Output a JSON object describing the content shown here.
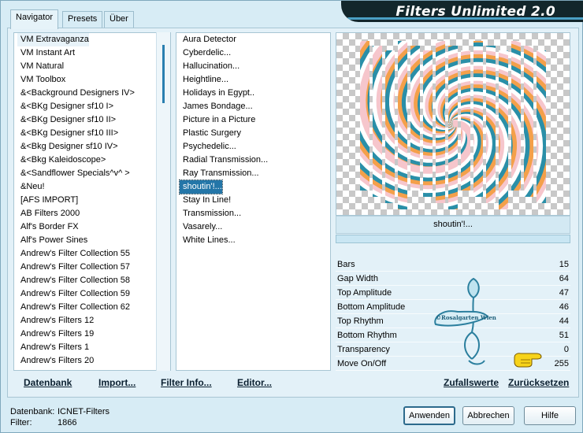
{
  "tabs": [
    {
      "label": "Navigator",
      "active": true
    },
    {
      "label": "Presets",
      "active": false
    },
    {
      "label": "Über",
      "active": false
    }
  ],
  "title": "Filters Unlimited 2.0",
  "categories": [
    {
      "label": "VM Extravaganza",
      "selected": false,
      "current": true
    },
    {
      "label": "VM Instant Art"
    },
    {
      "label": "VM Natural"
    },
    {
      "label": "VM Toolbox"
    },
    {
      "label": "&<Background Designers IV>"
    },
    {
      "label": "&<BKg Designer sf10 I>"
    },
    {
      "label": "&<BKg Designer sf10 II>"
    },
    {
      "label": "&<BKg Designer sf10 III>"
    },
    {
      "label": "&<Bkg Designer sf10 IV>"
    },
    {
      "label": "&<Bkg Kaleidoscope>"
    },
    {
      "label": "&<Sandflower Specials^v^ >"
    },
    {
      "label": "&Neu!"
    },
    {
      "label": "[AFS IMPORT]"
    },
    {
      "label": "AB Filters 2000"
    },
    {
      "label": "Alf's Border FX"
    },
    {
      "label": "Alf's Power Sines"
    },
    {
      "label": "Andrew's Filter Collection 55"
    },
    {
      "label": "Andrew's Filter Collection 57"
    },
    {
      "label": "Andrew's Filter Collection 58"
    },
    {
      "label": "Andrew's Filter Collection 59"
    },
    {
      "label": "Andrew's Filter Collection 62"
    },
    {
      "label": "Andrew's Filters 12"
    },
    {
      "label": "Andrew's Filters 19"
    },
    {
      "label": "Andrew's Filters 1"
    },
    {
      "label": "Andrew's Filters 20"
    }
  ],
  "filters": [
    {
      "label": "Aura Detector"
    },
    {
      "label": "Cyberdelic..."
    },
    {
      "label": "Hallucination..."
    },
    {
      "label": "Heightline..."
    },
    {
      "label": "Holidays in Egypt.."
    },
    {
      "label": "James Bondage..."
    },
    {
      "label": "Picture in a Picture"
    },
    {
      "label": "Plastic Surgery"
    },
    {
      "label": "Psychedelic..."
    },
    {
      "label": "Radial Transmission..."
    },
    {
      "label": "Ray Transmission..."
    },
    {
      "label": "shoutin'!...",
      "selected": true
    },
    {
      "label": "Stay In Line!"
    },
    {
      "label": "Transmission..."
    },
    {
      "label": "Vasarely..."
    },
    {
      "label": "White Lines..."
    }
  ],
  "preview": {
    "filter_name": "shoutin'!..."
  },
  "params": [
    {
      "label": "Bars",
      "value": "15"
    },
    {
      "label": "Gap Width",
      "value": "64"
    },
    {
      "label": "Top Amplitude",
      "value": "47"
    },
    {
      "label": "Bottom Amplitude",
      "value": "46"
    },
    {
      "label": "Top Rhythm",
      "value": "44"
    },
    {
      "label": "Bottom Rhythm",
      "value": "51"
    },
    {
      "label": "Transparency",
      "value": "0"
    },
    {
      "label": "Move On/Off",
      "value": "255"
    }
  ],
  "toolbar": {
    "datenbank": "Datenbank",
    "import": "Import...",
    "filter_info": "Filter Info...",
    "editor": "Editor...",
    "zufallswerte": "Zufallswerte",
    "zuruecksetzen": "Zurücksetzen"
  },
  "status": {
    "db_label": "Datenbank:",
    "db_value": "ICNET-Filters",
    "filter_label": "Filter:",
    "filter_value": "1866"
  },
  "buttons": {
    "apply": "Anwenden",
    "cancel": "Abbrechen",
    "help": "Hilfe"
  },
  "watermark_text": "©Rosalgarten Wien",
  "colors": {
    "accent": "#2476a8",
    "banner": "#12262b",
    "window": "#d7ecf5",
    "preview_orange": "#f4a04a",
    "preview_teal": "#2a8fa8",
    "preview_pink": "#f6c6cc"
  }
}
